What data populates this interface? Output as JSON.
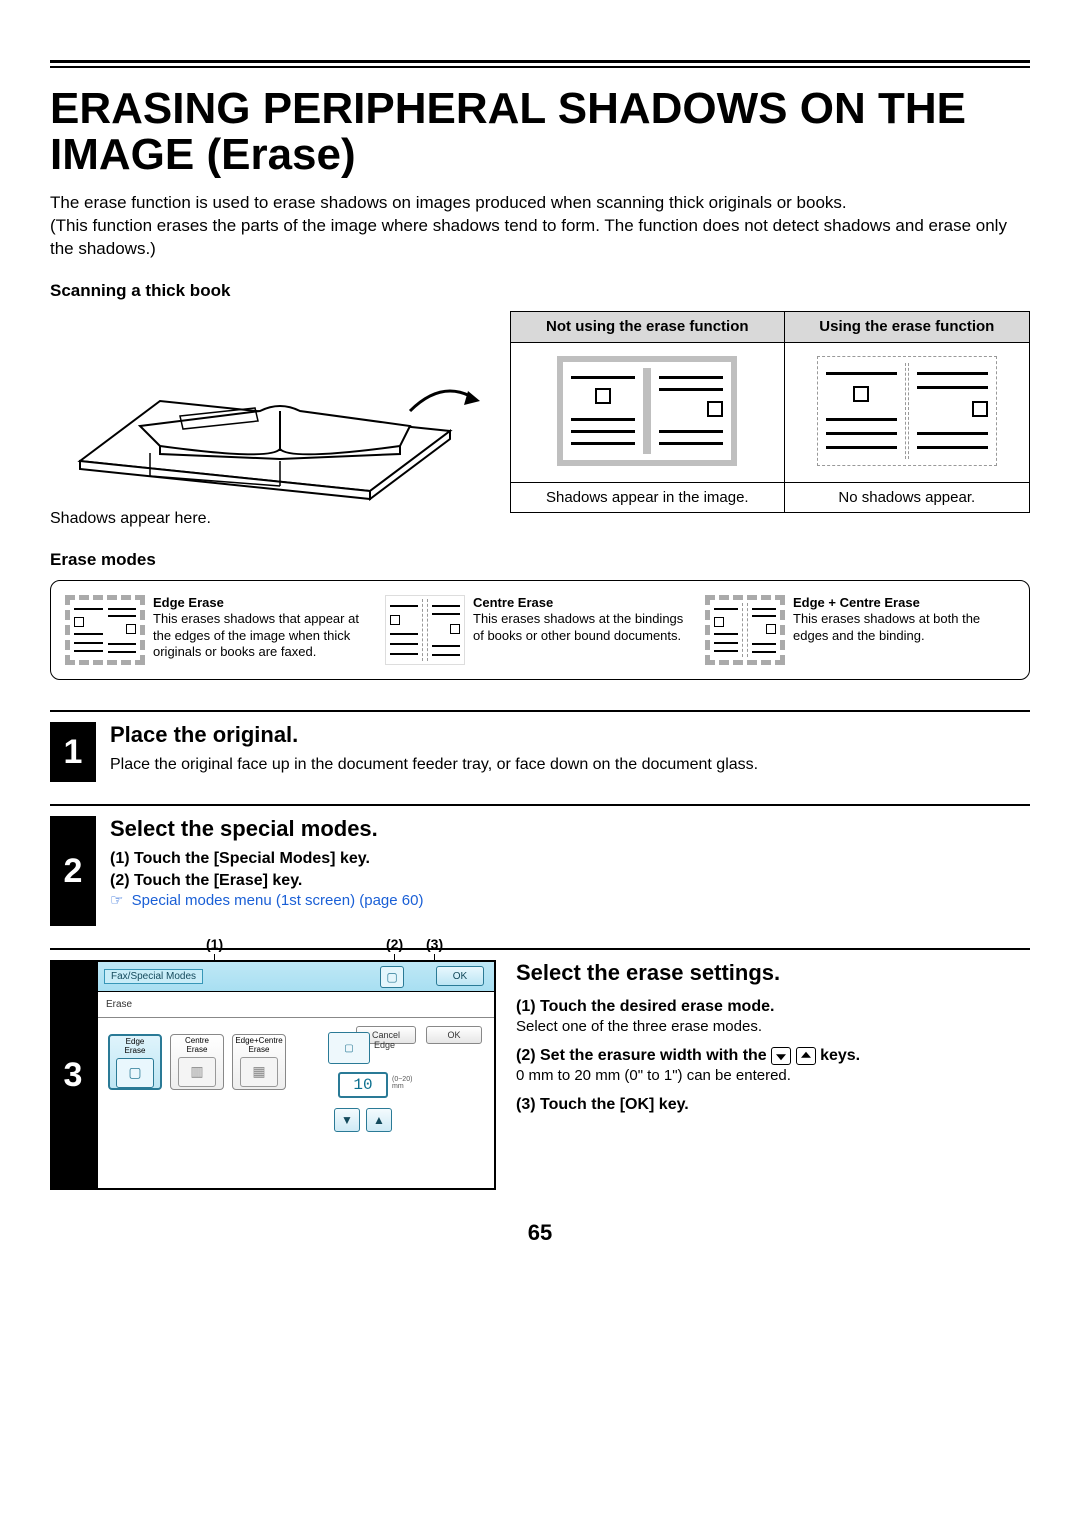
{
  "title": "ERASING PERIPHERAL SHADOWS ON THE IMAGE (Erase)",
  "intro_line1": "The erase function is used to erase shadows on images produced when scanning thick originals or books.",
  "intro_line2": "(This function erases the parts of the image where shadows tend to form. The function does not detect shadows and erase only the shadows.)",
  "scanning_heading": "Scanning a thick book",
  "shadows_caption": "Shadows appear here.",
  "compare": {
    "not_using": "Not using the erase function",
    "using": "Using the erase function",
    "caption_not": "Shadows appear in the image.",
    "caption_use": "No shadows appear."
  },
  "erase_modes_heading": "Erase modes",
  "modes": {
    "edge_title": "Edge Erase",
    "edge_desc": "This erases shadows that appear at the edges of the image when thick originals or books are faxed.",
    "centre_title": "Centre Erase",
    "centre_desc": "This erases shadows at the bindings of books or other bound documents.",
    "both_title": "Edge + Centre Erase",
    "both_desc": "This erases shadows at both the edges and the binding."
  },
  "steps": {
    "s1_title": "Place the original.",
    "s1_desc": "Place the original face up in the document feeder tray, or face down on the document glass.",
    "s2_title": "Select the special modes.",
    "s2_a": "(1)  Touch the [Special Modes] key.",
    "s2_b": "(2)  Touch the [Erase] key.",
    "s2_link_text": "Special modes menu (1st screen)",
    "s2_link_page": " (page 60)",
    "s3_title": "Select the erase settings.",
    "s3_1": "(1)  Touch the desired erase mode.",
    "s3_1_note": "Select one of the three erase modes.",
    "s3_2_pre": "(2)  Set the erasure width with the ",
    "s3_2_post": " keys.",
    "s3_2_note": "0 mm to 20 mm (0\" to 1\") can be entered.",
    "s3_3": "(3)  Touch the [OK] key."
  },
  "panel": {
    "tab": "Fax/Special Modes",
    "subtext": "Erase",
    "cancel": "Cancel",
    "ok": "OK",
    "btn1a": "Edge",
    "btn1b": "Erase",
    "btn2a": "Centre",
    "btn2b": "Erase",
    "btn3a": "Edge+Centre",
    "btn3b": "Erase",
    "edge_label": "Edge",
    "value": "10",
    "range": "(0~20)\nmm"
  },
  "callouts": {
    "c1": "(1)",
    "c2": "(2)",
    "c3": "(3)"
  },
  "page_number": "65"
}
